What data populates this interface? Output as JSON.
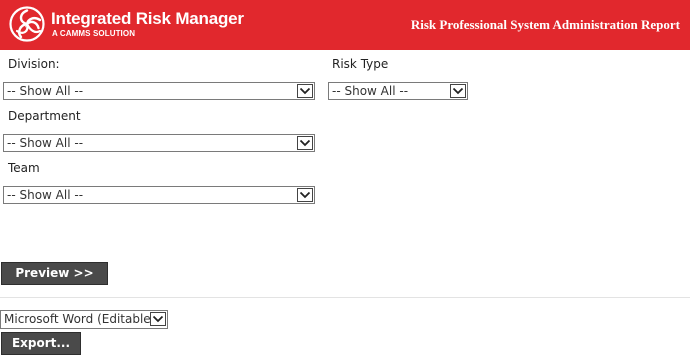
{
  "header": {
    "brand_name": "Integrated Risk Manager",
    "brand_tagline": "A CAMMS SOLUTION",
    "report_title": "Risk Professional System Administration Report",
    "background_color": "#e1282d"
  },
  "filters": {
    "division": {
      "label": "Division:",
      "value": "-- Show All --"
    },
    "risk_type": {
      "label": "Risk Type",
      "value": "-- Show All --"
    },
    "department": {
      "label": "Department",
      "value": "-- Show All --"
    },
    "team": {
      "label": "Team",
      "value": "-- Show All --"
    }
  },
  "actions": {
    "preview_label": "Preview >>",
    "export_format": "Microsoft Word (Editable)",
    "export_label": "Export..."
  },
  "icons": {
    "logo": "camms-swirl-logo-icon",
    "dropdown": "chevron-down-icon"
  }
}
